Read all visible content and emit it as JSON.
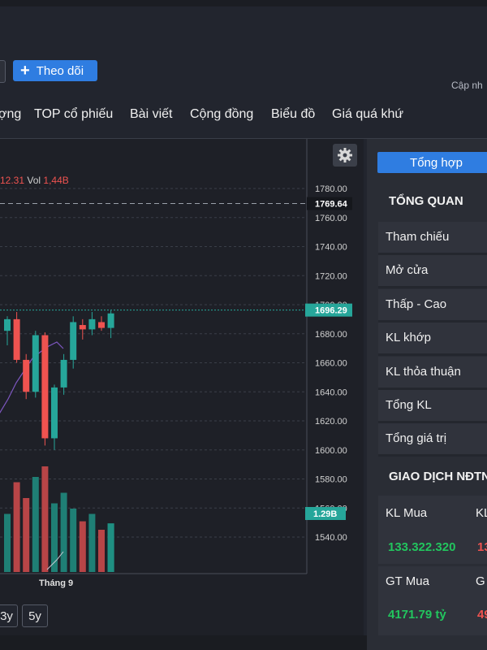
{
  "header": {
    "follow_label": "Theo dõi",
    "updated_label": "Cập nh"
  },
  "nav": {
    "items": [
      "ợng",
      "TOP cổ phiếu",
      "Bài viết",
      "Cộng đồng",
      "Biểu đồ",
      "Giá quá khứ"
    ]
  },
  "chart": {
    "legend_value": "12.31",
    "vol_label": "Vol",
    "vol_value": "1,44B",
    "x_tick": "Tháng 9",
    "range_buttons": [
      "3y",
      "5y"
    ],
    "colors": {
      "up": "#26a69a",
      "down": "#ef5350",
      "ma": "#7e57c2"
    }
  },
  "chart_data": {
    "type": "candlestick",
    "y_ticks": [
      1540,
      1560,
      1580,
      1600,
      1620,
      1640,
      1660,
      1680,
      1700,
      1720,
      1740,
      1760,
      1780
    ],
    "ylim": [
      1540,
      1780
    ],
    "price_labels": {
      "reference": "1769.64",
      "current": "1696.29",
      "volume": "1.29B"
    },
    "candles": [
      {
        "o": 1682,
        "h": 1692,
        "l": 1672,
        "c": 1690
      },
      {
        "o": 1690,
        "h": 1695,
        "l": 1660,
        "c": 1662
      },
      {
        "o": 1662,
        "h": 1666,
        "l": 1635,
        "c": 1640
      },
      {
        "o": 1640,
        "h": 1682,
        "l": 1636,
        "c": 1679
      },
      {
        "o": 1679,
        "h": 1681,
        "l": 1603,
        "c": 1608
      },
      {
        "o": 1608,
        "h": 1645,
        "l": 1600,
        "c": 1643
      },
      {
        "o": 1643,
        "h": 1666,
        "l": 1638,
        "c": 1662
      },
      {
        "o": 1662,
        "h": 1692,
        "l": 1656,
        "c": 1688
      },
      {
        "o": 1686,
        "h": 1690,
        "l": 1676,
        "c": 1683
      },
      {
        "o": 1683,
        "h": 1695,
        "l": 1679,
        "c": 1690
      },
      {
        "o": 1688,
        "h": 1692,
        "l": 1682,
        "c": 1684
      },
      {
        "o": 1684,
        "h": 1696,
        "l": 1677,
        "c": 1694
      }
    ],
    "volumes": [
      0.55,
      0.85,
      0.7,
      0.9,
      1.0,
      0.65,
      0.75,
      0.6,
      0.48,
      0.55,
      0.4,
      0.46
    ]
  },
  "side": {
    "tab_label": "Tổng hợp",
    "overview_title": "TỔNG QUAN",
    "rows": [
      "Tham chiếu",
      "Mở cửa",
      "Thấp - Cao",
      "KL khớp",
      "KL thỏa thuận",
      "Tổng KL",
      "Tổng giá trị"
    ],
    "foreign_title": "GIAO DỊCH NĐTN",
    "kl_mua_label": "KL Mua",
    "kl_ban_label": "KL",
    "kl_mua_value": "133.322.320",
    "kl_ban_value": "13",
    "gt_mua_label": "GT Mua",
    "gt_ban_label": "G",
    "gt_mua_value": "4171.79 tỷ",
    "gt_ban_value": "49"
  }
}
